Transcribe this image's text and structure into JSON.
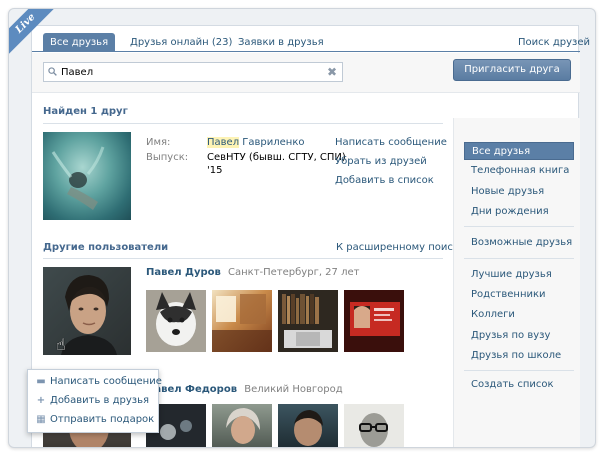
{
  "ribbon": "Live",
  "tabs": [
    {
      "label": "Все друзья"
    },
    {
      "label": "Друзья онлайн (23)"
    },
    {
      "label": "Заявки в друзья"
    },
    {
      "label": "Поиск друзей"
    }
  ],
  "search": {
    "value": "Павел",
    "clear_icon": "✖"
  },
  "invite_button": "Пригласить друга",
  "found": {
    "title": "Найден 1 друг",
    "name_label": "Имя:",
    "name_first": "Павел",
    "name_last": " Гавриленко",
    "grad_label": "Выпуск:",
    "grad_value_1": "СевНТУ (бывш. СГТУ, СПИ)",
    "grad_value_2": "'15",
    "actions": [
      "Написать сообщение",
      "Убрать из друзей",
      "Добавить в список"
    ]
  },
  "others": {
    "title": "Другие пользователи",
    "advanced_link": "К расширенному поиску",
    "users": [
      {
        "name": "Павел Дуров",
        "info": "Санкт-Петербург, 27 лет"
      },
      {
        "name": "Павел Федоров",
        "info": "Великий Новгород"
      }
    ]
  },
  "popup": {
    "items": [
      {
        "label": "Написать сообщение",
        "icon": "message-icon"
      },
      {
        "label": "Добавить в друзья",
        "icon": "plus-icon"
      },
      {
        "label": "Отправить подарок",
        "icon": "gift-icon"
      }
    ]
  },
  "menu": {
    "items": [
      "Все друзья",
      "Телефонная книга",
      "Новые друзья",
      "Дни рождения",
      "Возможные друзья",
      "Лучшие друзья",
      "Родственники",
      "Коллеги",
      "Друзья по вузу",
      "Друзья по школе",
      "Создать список"
    ],
    "active_index": 0
  },
  "colors": {
    "accent": "#5b7fa6",
    "link": "#2b587a",
    "title": "#45688e"
  }
}
